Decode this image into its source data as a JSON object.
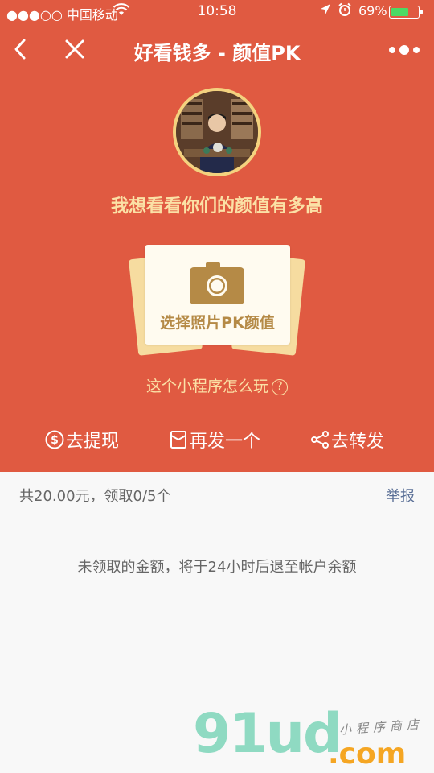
{
  "status_bar": {
    "carrier": "●●●○○ 中国移动",
    "time": "10:58",
    "battery_percent": "69%",
    "battery_level": 0.69
  },
  "nav": {
    "title": "好看钱多 - 颜值PK"
  },
  "hero": {
    "headline": "我想看看你们的颜值有多高",
    "photo_card_label": "选择照片PK颜值",
    "how_to_play": "这个小程序怎么玩",
    "help_glyph": "?"
  },
  "actions": [
    {
      "label": "去提现",
      "icon": "dollar-icon"
    },
    {
      "label": "再发一个",
      "icon": "envelope-icon"
    },
    {
      "label": "去转发",
      "icon": "share-icon"
    }
  ],
  "summary": {
    "text": "共20.00元，领取0/5个",
    "report_label": "举报"
  },
  "notice": "未领取的金额，将于24小时后退至帐户余额",
  "watermark": {
    "brand": "91ud",
    "domain": ".com",
    "tagline": "小程序商店"
  },
  "colors": {
    "header_bg": "#e05a41",
    "gold_text": "#fbe1a6",
    "card_text": "#b58a46",
    "link": "#5a6f96"
  }
}
